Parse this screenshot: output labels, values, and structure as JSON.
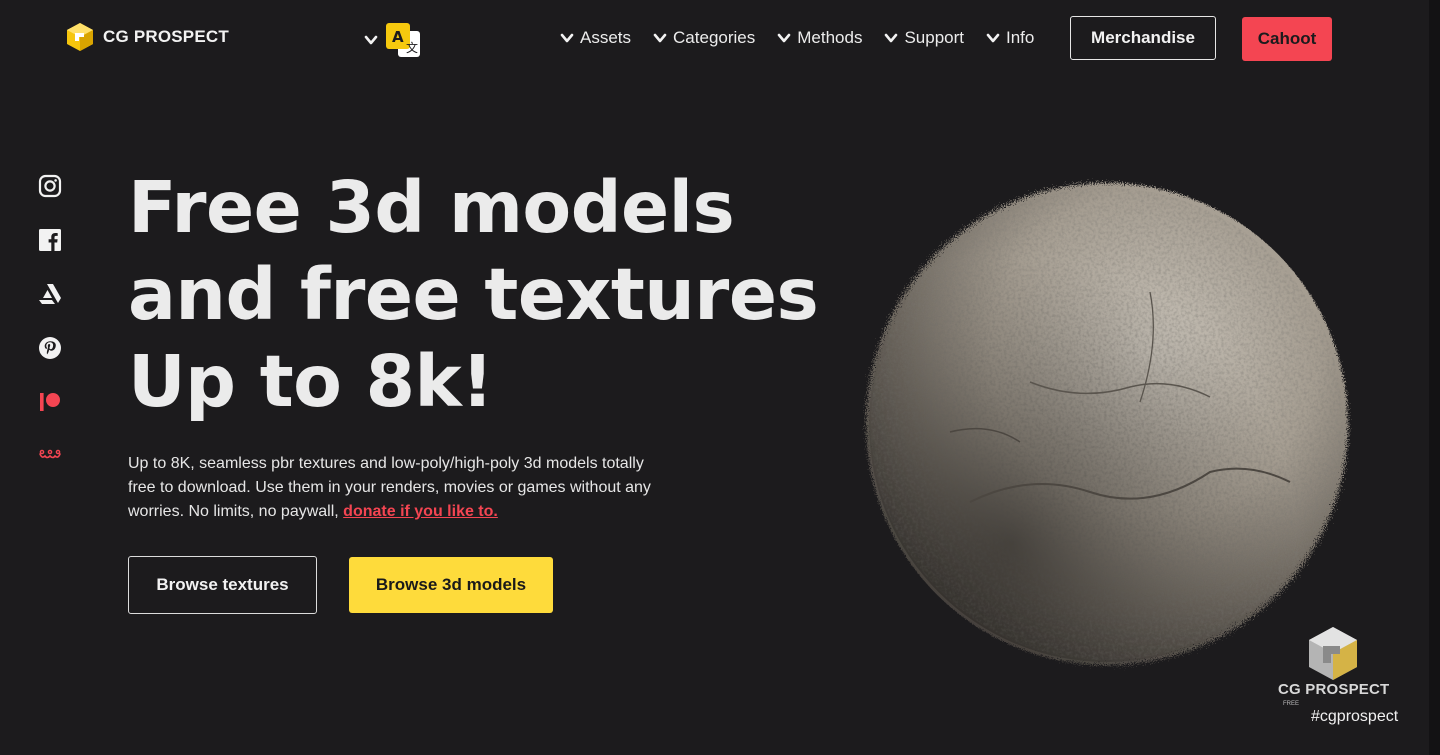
{
  "header": {
    "logo_text": "CG PROSPECT",
    "nav": [
      {
        "label": "Assets"
      },
      {
        "label": "Categories"
      },
      {
        "label": "Methods"
      },
      {
        "label": "Support"
      },
      {
        "label": "Info"
      }
    ],
    "merch_label": "Merchandise",
    "cahoot_label": "Cahoot"
  },
  "social": [
    "instagram-icon",
    "facebook-icon",
    "artstation-icon",
    "pinterest-icon",
    "patreon-icon",
    "kofi-icon"
  ],
  "hero": {
    "title_lines": [
      "Free 3d models",
      "and free textures",
      "Up to 8k!"
    ],
    "description": "Up to 8K, seamless pbr textures and low-poly/high-poly 3d models totally free to download. Use them in your renders, movies or games without any worries. No limits, no paywall, ",
    "donate_link": "donate if you like to.",
    "browse_textures_label": "Browse textures",
    "browse_models_label": "Browse 3d models"
  },
  "watermark": {
    "brand": "CG PROSPECT",
    "sub": "FREE",
    "hashtag": "#cgprospect"
  },
  "colors": {
    "background": "#1c1b1d",
    "accent_red": "#f44552",
    "accent_yellow": "#fedb3b",
    "text": "#ececec"
  }
}
